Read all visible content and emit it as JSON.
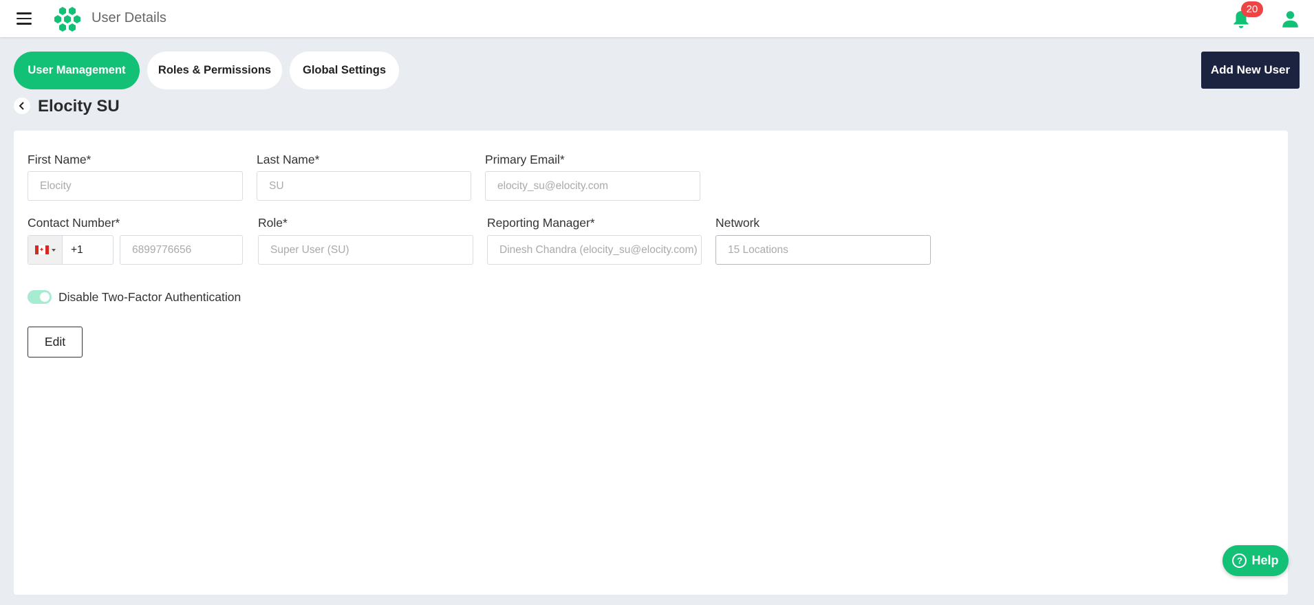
{
  "header": {
    "title": "User Details",
    "notification_count": "20",
    "icons": {
      "menu": "hamburger-icon",
      "logo": "hexagon-logo",
      "notifications": "bell-icon",
      "profile": "user-icon"
    }
  },
  "tabs": [
    {
      "label": "User Management",
      "active": true
    },
    {
      "label": "Roles & Permissions",
      "active": false
    },
    {
      "label": "Global Settings",
      "active": false
    }
  ],
  "add_user_label": "Add New User",
  "user_title": "Elocity SU",
  "form": {
    "first_name": {
      "label": "First Name*",
      "value": "Elocity"
    },
    "last_name": {
      "label": "Last Name*",
      "value": "SU"
    },
    "primary_email": {
      "label": "Primary Email*",
      "value": "elocity_su@elocity.com"
    },
    "contact": {
      "label": "Contact Number*",
      "dial_code": "+1",
      "value": "6899776656",
      "country": "CA"
    },
    "role": {
      "label": "Role*",
      "value": "Super User (SU)"
    },
    "reporting_manager": {
      "label": "Reporting Manager*",
      "value": "Dinesh Chandra (elocity_su@elocity.com)"
    },
    "network": {
      "label": "Network",
      "value": "15 Locations"
    },
    "two_factor": {
      "label": "Disable Two-Factor Authentication",
      "enabled": true
    },
    "edit_label": "Edit"
  },
  "help_label": "Help",
  "colors": {
    "accent": "#12c176",
    "dark_button": "#1c2340",
    "badge": "#ef4444",
    "background": "#e9edf2"
  }
}
